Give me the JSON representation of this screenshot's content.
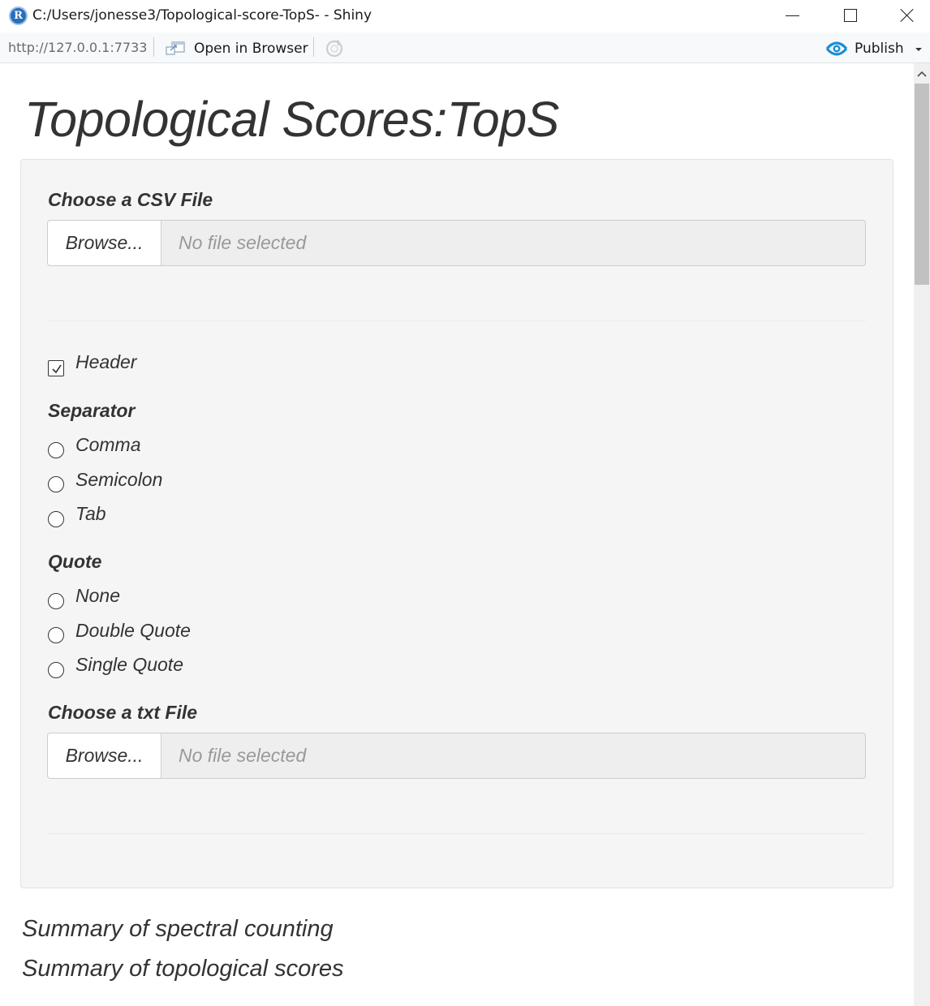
{
  "window": {
    "title": "C:/Users/jonesse3/Topological-score-TopS- - Shiny",
    "app_icon_letter": "R"
  },
  "toolbar": {
    "url": "http://127.0.0.1:7733",
    "open_in_browser_label": "Open in Browser",
    "publish_label": "Publish"
  },
  "page": {
    "title": "Topological Scores:TopS"
  },
  "csv_input": {
    "label": "Choose a CSV File",
    "browse_label": "Browse...",
    "file_placeholder": "No file selected"
  },
  "header_option": {
    "label": "Header",
    "checked": true
  },
  "separator": {
    "label": "Separator",
    "options": [
      "Comma",
      "Semicolon",
      "Tab"
    ]
  },
  "quote": {
    "label": "Quote",
    "options": [
      "None",
      "Double Quote",
      "Single Quote"
    ]
  },
  "txt_input": {
    "label": "Choose a txt File",
    "browse_label": "Browse...",
    "file_placeholder": "No file selected"
  },
  "summaries": {
    "spectral": "Summary of spectral counting",
    "topological": "Summary of topological scores"
  },
  "colors": {
    "publish_blue": "#1a8fd6",
    "well_bg": "#f5f5f5",
    "app_icon_blue": "#2a6ebb"
  }
}
